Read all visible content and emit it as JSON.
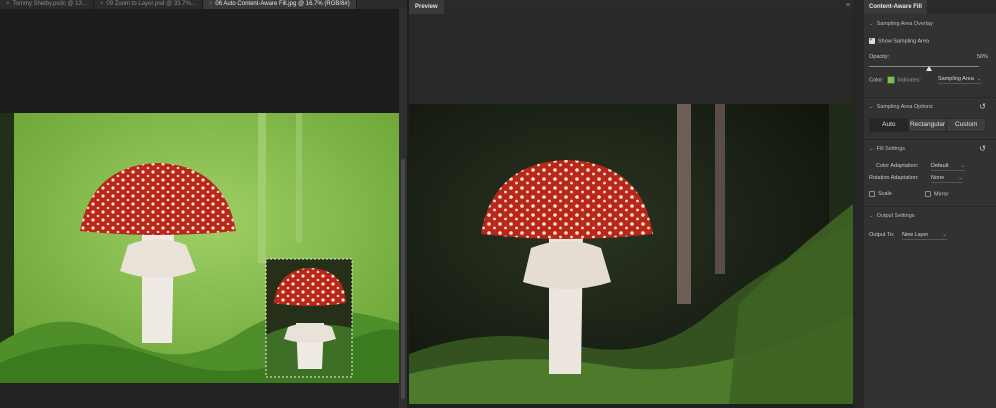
{
  "document": {
    "tabs": [
      {
        "label": "Tommy Shelby.psdc @ 13...",
        "active": false
      },
      {
        "label": "09 Zoom to Layer.psd @ 33.7%...",
        "active": false
      },
      {
        "label": "06 Auto Content-Aware Fill.jpg @ 16.7% (RGB/8#)",
        "active": true
      }
    ]
  },
  "preview": {
    "tab_label": "Preview",
    "menu_icon": "panel-menu-icon"
  },
  "panel": {
    "title": "Content-Aware Fill",
    "sampling_overlay": {
      "section_label": "Sampling Area Overlay",
      "show_label": "Show Sampling Area",
      "show_checked": true,
      "opacity_label": "Opacity:",
      "opacity_value": "50%",
      "opacity_fraction": 0.5,
      "color_label": "Color:",
      "overlay_color": "#7ec33f",
      "indicates_label": "Indicates:",
      "indicates_value": "Sampling Area"
    },
    "sampling_options": {
      "section_label": "Sampling Area Options",
      "buttons": [
        "Auto",
        "Rectangular",
        "Custom"
      ],
      "selected": "Auto"
    },
    "fill_settings": {
      "section_label": "Fill Settings",
      "color_adaptation_label": "Color Adaptation:",
      "color_adaptation_value": "Default",
      "rotation_adaptation_label": "Rotation Adaptation:",
      "rotation_adaptation_value": "None",
      "scale_label": "Scale",
      "mirror_label": "Mirror"
    },
    "output_settings": {
      "section_label": "Output Settings",
      "output_to_label": "Output To:",
      "output_to_value": "New Layer"
    }
  },
  "colors": {
    "mushroom_cap": "#b8261c",
    "overlay_green": "#7ec33f"
  }
}
